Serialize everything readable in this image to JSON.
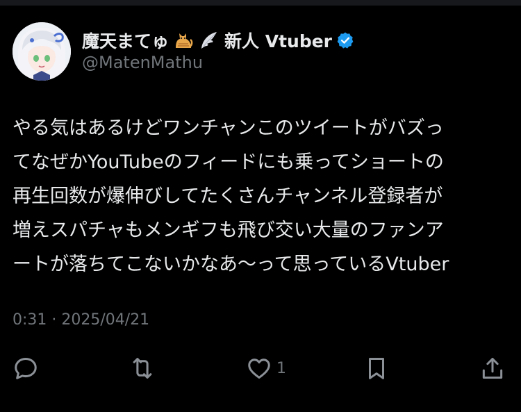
{
  "author": {
    "display_name": "魔天まてゅ",
    "display_name_suffix": "新人 Vtuber",
    "handle": "@MatenMathu",
    "name_emojis": [
      "cat-emoji",
      "wing-emoji"
    ],
    "verified": true
  },
  "tweet": {
    "lines": [
      "やる気はあるけどワンチャンこのツイートがバズっ",
      "てなぜかYouTubeのフィードにも乗ってショートの",
      "再生回数が爆伸びしてたくさんチャンネル登録者が",
      "増えスパチャもメンギフも飛び交い大量のファンア",
      "ートが落ちてこないかなあ〜って思っているVtuber"
    ],
    "meta": "0:31 · 2025/04/21"
  },
  "actions": {
    "reply_icon": "reply-icon",
    "retweet_icon": "retweet-icon",
    "like_icon": "heart-icon",
    "like_count": "1",
    "bookmark_icon": "bookmark-icon",
    "share_icon": "share-icon"
  },
  "colors": {
    "background": "#000000",
    "text": "#e7e9ea",
    "secondary": "#71767b",
    "verified": "#1d9bf0"
  }
}
